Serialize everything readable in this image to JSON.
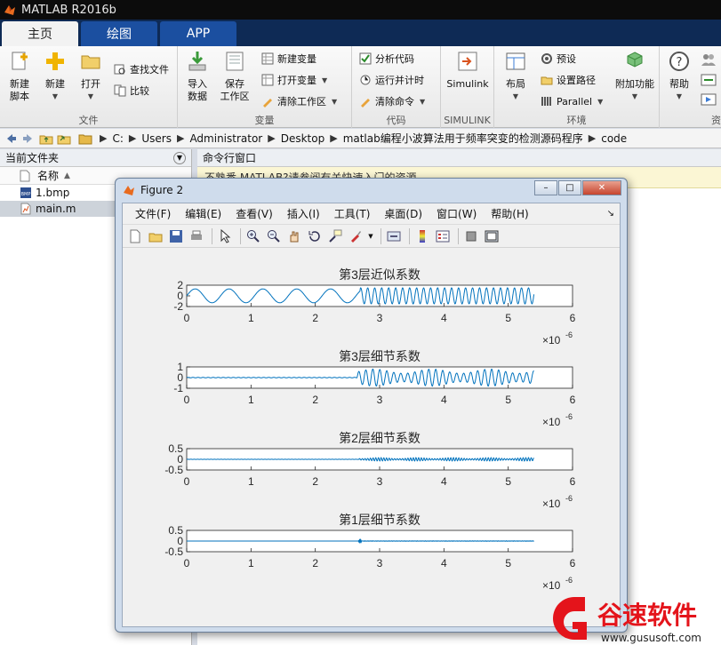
{
  "window": {
    "title": "MATLAB R2016b"
  },
  "tabs": [
    {
      "label": "主页"
    },
    {
      "label": "绘图"
    },
    {
      "label": "APP"
    }
  ],
  "ribbon": {
    "file": {
      "label": "文件",
      "new_script": "新建\n脚本",
      "new": "新建",
      "open": "打开",
      "find_files": "查找文件",
      "compare": "比较"
    },
    "variable": {
      "label": "变量",
      "import_data": "导入\n数据",
      "save_workspace": "保存\n工作区",
      "new_variable": "新建变量",
      "open_variable": "打开变量",
      "clear_workspace": "清除工作区"
    },
    "code": {
      "label": "代码",
      "analyze_code": "分析代码",
      "run_time": "运行并计时",
      "clear_commands": "清除命令"
    },
    "simulink": {
      "label": "SIMULINK",
      "simulink": "Simulink"
    },
    "environment": {
      "label": "环境",
      "layout": "布局",
      "preferences": "预设",
      "set_path": "设置路径",
      "parallel": "Parallel",
      "addons": "附加功能"
    },
    "resources": {
      "label": "资",
      "help": "帮助"
    }
  },
  "address": {
    "crumbs": [
      "C:",
      "Users",
      "Administrator",
      "Desktop",
      "matlab编程小波算法用于频率突变的检测源码程序",
      "code"
    ]
  },
  "current_folder": {
    "title": "当前文件夹",
    "column_name": "名称",
    "sort_arrow": "▲",
    "files": [
      {
        "name": "1.bmp",
        "icon": "bmp-file-icon"
      },
      {
        "name": "main.m",
        "icon": "m-file-icon"
      }
    ]
  },
  "command_window": {
    "title": "命令行窗口",
    "notice": "不熟悉 MATLAB?请参阅有关快速入门的资源。"
  },
  "figure": {
    "title": "Figure 2",
    "menu": [
      "文件(F)",
      "编辑(E)",
      "查看(V)",
      "插入(I)",
      "工具(T)",
      "桌面(D)",
      "窗口(W)",
      "帮助(H)"
    ],
    "toolbar_icons": [
      "new-figure-icon",
      "open-file-icon",
      "save-icon",
      "print-icon",
      "pointer-icon",
      "zoom-in-icon",
      "zoom-out-icon",
      "pan-icon",
      "rotate-icon",
      "data-cursor-icon",
      "brush-icon",
      "link-plot-icon",
      "colorbar-icon",
      "legend-icon",
      "hide-plot-tools-icon",
      "show-plot-tools-icon"
    ]
  },
  "chart_data": [
    {
      "type": "line",
      "title": "第3层近似系数",
      "xlim": [
        0,
        6
      ],
      "ylim": [
        -2,
        2
      ],
      "yticks": [
        "2",
        "0",
        "-2"
      ],
      "xticks": [
        "0",
        "1",
        "2",
        "3",
        "4",
        "5",
        "6"
      ],
      "x_multiplier": "×10",
      "x_exponent": "-6",
      "series": [
        {
          "color": "#0072bd",
          "signal": "approx",
          "x_end": 5.4,
          "amplitude_low": 1.3,
          "amplitude_high": 1.5,
          "change_x": 2.7
        }
      ]
    },
    {
      "type": "line",
      "title": "第3层细节系数",
      "xlim": [
        0,
        6
      ],
      "ylim": [
        -1,
        1
      ],
      "yticks": [
        "1",
        "0",
        "-1"
      ],
      "xticks": [
        "0",
        "1",
        "2",
        "3",
        "4",
        "5",
        "6"
      ],
      "x_multiplier": "×10",
      "x_exponent": "-6",
      "series": [
        {
          "color": "#0072bd",
          "signal": "detail3",
          "x_end": 5.4,
          "amplitude_low": 0.02,
          "amplitude_high": 0.8,
          "change_x": 2.65
        }
      ]
    },
    {
      "type": "line",
      "title": "第2层细节系数",
      "xlim": [
        0,
        6
      ],
      "ylim": [
        -0.5,
        0.5
      ],
      "yticks": [
        "0.5",
        "0",
        "-0.5"
      ],
      "xticks": [
        "0",
        "1",
        "2",
        "3",
        "4",
        "5",
        "6"
      ],
      "x_multiplier": "×10",
      "x_exponent": "-6",
      "series": [
        {
          "color": "#0072bd",
          "signal": "detail2",
          "x_end": 5.4,
          "amplitude_low": 0.005,
          "amplitude_high": 0.08,
          "change_x": 2.68
        }
      ]
    },
    {
      "type": "line",
      "title": "第1层细节系数",
      "xlim": [
        0,
        6
      ],
      "ylim": [
        -0.5,
        0.5
      ],
      "yticks": [
        "0.5",
        "0",
        "-0.5"
      ],
      "xticks": [
        "0",
        "1",
        "2",
        "3",
        "4",
        "5",
        "6"
      ],
      "x_multiplier": "×10",
      "x_exponent": "-6",
      "series": [
        {
          "color": "#0072bd",
          "signal": "detail1",
          "x_end": 5.4,
          "amplitude_low": 0.002,
          "amplitude_high": 0.01,
          "spike_x": 2.7,
          "spike_value": 0.12
        }
      ]
    }
  ],
  "watermark": {
    "brand": "谷速软件",
    "url": "www.gususoft.com",
    "color": "#e4141b"
  }
}
